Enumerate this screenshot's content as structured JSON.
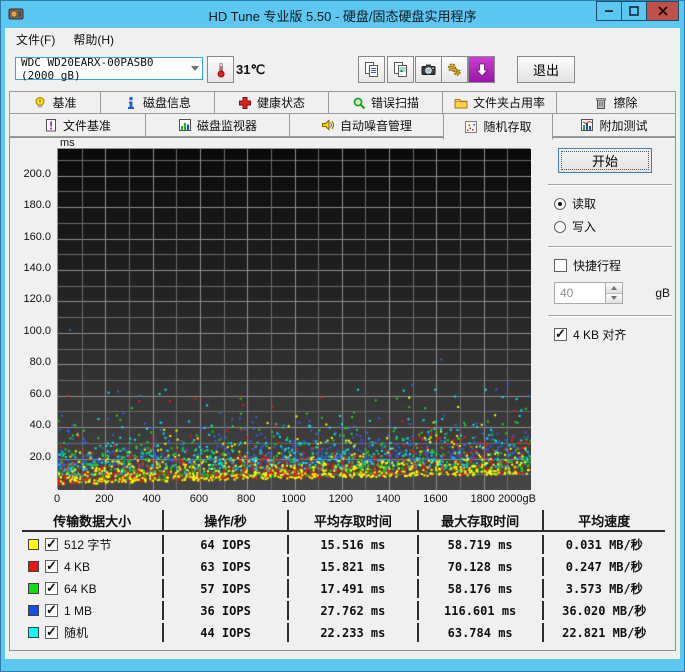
{
  "window": {
    "title": "HD Tune 专业版 5.50 - 硬盘/固态硬盘实用程序"
  },
  "menu": {
    "items": [
      {
        "label": "文件(F)"
      },
      {
        "label": "帮助(H)"
      }
    ]
  },
  "toolbar": {
    "drive": "WDC WD20EARX-00PASB0 (2000 gB)",
    "temperature": "31℃",
    "exit_label": "退出"
  },
  "tabs": {
    "row1": [
      {
        "label": "基准"
      },
      {
        "label": "磁盘信息"
      },
      {
        "label": "健康状态"
      },
      {
        "label": "错误扫描"
      },
      {
        "label": "文件夹占用率"
      },
      {
        "label": "擦除"
      }
    ],
    "row2": [
      {
        "label": "文件基准"
      },
      {
        "label": "磁盘监视器"
      },
      {
        "label": "自动噪音管理"
      },
      {
        "label": "随机存取",
        "active": true
      },
      {
        "label": "附加测试"
      }
    ]
  },
  "controls": {
    "start_label": "开始",
    "read_label": "读取",
    "read_selected": true,
    "write_label": "写入",
    "write_selected": false,
    "short_stroke_label": "快捷行程",
    "short_stroke_checked": false,
    "short_stroke_value": "40",
    "short_stroke_unit": "gB",
    "align_label": "4 KB 对齐",
    "align_checked": true
  },
  "chart_data": {
    "type": "scatter",
    "xlabel": "gB",
    "ylabel": "ms",
    "xlim": [
      0,
      2000
    ],
    "ylim": [
      0,
      200
    ],
    "x_tick_step": 200,
    "y_tick_step": 20,
    "grid": true,
    "series": [
      {
        "name": "512 字节",
        "color": "#ffff00",
        "iops": 64,
        "avg_access_ms": 15.516,
        "max_access_ms": 58.719,
        "avg_speed": "0.031 MB/秒",
        "points": 650,
        "band_offset": 0,
        "spread": 7
      },
      {
        "name": "4 KB",
        "color": "#f01818",
        "iops": 63,
        "avg_access_ms": 15.821,
        "max_access_ms": 70.128,
        "avg_speed": "0.247 MB/秒",
        "points": 650,
        "band_offset": 0.5,
        "spread": 7.5
      },
      {
        "name": "64 KB",
        "color": "#1ad41a",
        "iops": 57,
        "avg_access_ms": 17.491,
        "max_access_ms": 58.176,
        "avg_speed": "3.573 MB/秒",
        "points": 600,
        "band_offset": 1,
        "spread": 9
      },
      {
        "name": "1 MB",
        "color": "#2a62f5",
        "iops": 36,
        "avg_access_ms": 27.762,
        "max_access_ms": 116.601,
        "avg_speed": "36.020 MB/秒",
        "points": 430,
        "band_offset": 10,
        "spread": 8
      },
      {
        "name": "随机",
        "color": "#00e6ff",
        "iops": 44,
        "avg_access_ms": 22.233,
        "max_access_ms": 63.784,
        "avg_speed": "22.821 MB/秒",
        "points": 480,
        "band_offset": 5,
        "spread": 9
      }
    ],
    "draw_order": [
      3,
      4,
      2,
      1,
      0
    ]
  },
  "table": {
    "headers": [
      "传输数据大小",
      "操作/秒",
      "平均存取时间",
      "最大存取时间",
      "平均速度"
    ],
    "rows": [
      {
        "color": "#ffff00",
        "checked": true,
        "label": "512 字节",
        "ops": "64 IOPS",
        "avg": "15.516 ms",
        "max": "58.719 ms",
        "speed": "0.031 MB/秒"
      },
      {
        "color": "#e81414",
        "checked": true,
        "label": "4 KB",
        "ops": "63 IOPS",
        "avg": "15.821 ms",
        "max": "70.128 ms",
        "speed": "0.247 MB/秒"
      },
      {
        "color": "#14dc14",
        "checked": true,
        "label": "64 KB",
        "ops": "57 IOPS",
        "avg": "17.491 ms",
        "max": "58.176 ms",
        "speed": "3.573 MB/秒"
      },
      {
        "color": "#1450e8",
        "checked": true,
        "label": "1 MB",
        "ops": "36 IOPS",
        "avg": "27.762 ms",
        "max": "116.601 ms",
        "speed": "36.020 MB/秒"
      },
      {
        "color": "#00ffff",
        "checked": true,
        "label": "随机",
        "ops": "44 IOPS",
        "avg": "22.233 ms",
        "max": "63.784 ms",
        "speed": "22.821 MB/秒"
      }
    ]
  }
}
